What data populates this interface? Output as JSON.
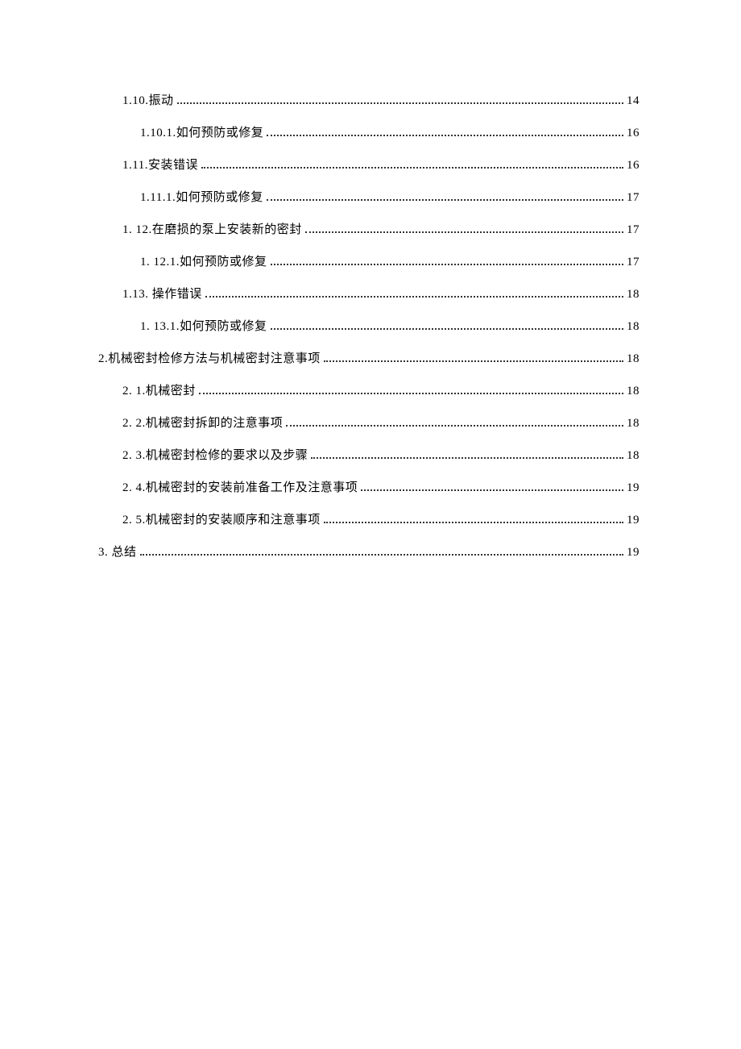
{
  "toc": [
    {
      "id": "e1_10",
      "level": 2,
      "label": "1.10.振动",
      "page": "14"
    },
    {
      "id": "e1_10_1",
      "level": 3,
      "label": "1.10.1.如何预防或修复",
      "page": "16"
    },
    {
      "id": "e1_11",
      "level": 2,
      "label": "1.11.安装错误",
      "page": "16"
    },
    {
      "id": "e1_11_1",
      "level": 3,
      "label": "1.11.1.如何预防或修复",
      "page": "17"
    },
    {
      "id": "e1_12",
      "level": 2,
      "label": "1. 12.在磨损的泵上安装新的密封",
      "page": "17"
    },
    {
      "id": "e1_12_1",
      "level": 3,
      "label": "1. 12.1.如何预防或修复",
      "page": "17"
    },
    {
      "id": "e1_13",
      "level": 2,
      "label": "1.13. 操作错误",
      "page": "18"
    },
    {
      "id": "e1_13_1",
      "level": 3,
      "label": "1. 13.1.如何预防或修复",
      "page": "18"
    },
    {
      "id": "e2",
      "level": 1,
      "label": "2.机械密封检修方法与机械密封注意事项",
      "page": "18"
    },
    {
      "id": "e2_1",
      "level": 2,
      "label": "2. 1.机械密封",
      "page": "18"
    },
    {
      "id": "e2_2",
      "level": 2,
      "label": "2. 2.机械密封拆卸的注意事项",
      "page": "18"
    },
    {
      "id": "e2_3",
      "level": 2,
      "label": "2. 3.机械密封检修的要求以及步骤",
      "page": "18"
    },
    {
      "id": "e2_4",
      "level": 2,
      "label": "2. 4.机械密封的安装前准备工作及注意事项",
      "page": "19"
    },
    {
      "id": "e2_5",
      "level": 2,
      "label": "2. 5.机械密封的安装顺序和注意事项",
      "page": "19"
    },
    {
      "id": "e3",
      "level": 1,
      "label": "3. 总结",
      "page": "19"
    }
  ]
}
